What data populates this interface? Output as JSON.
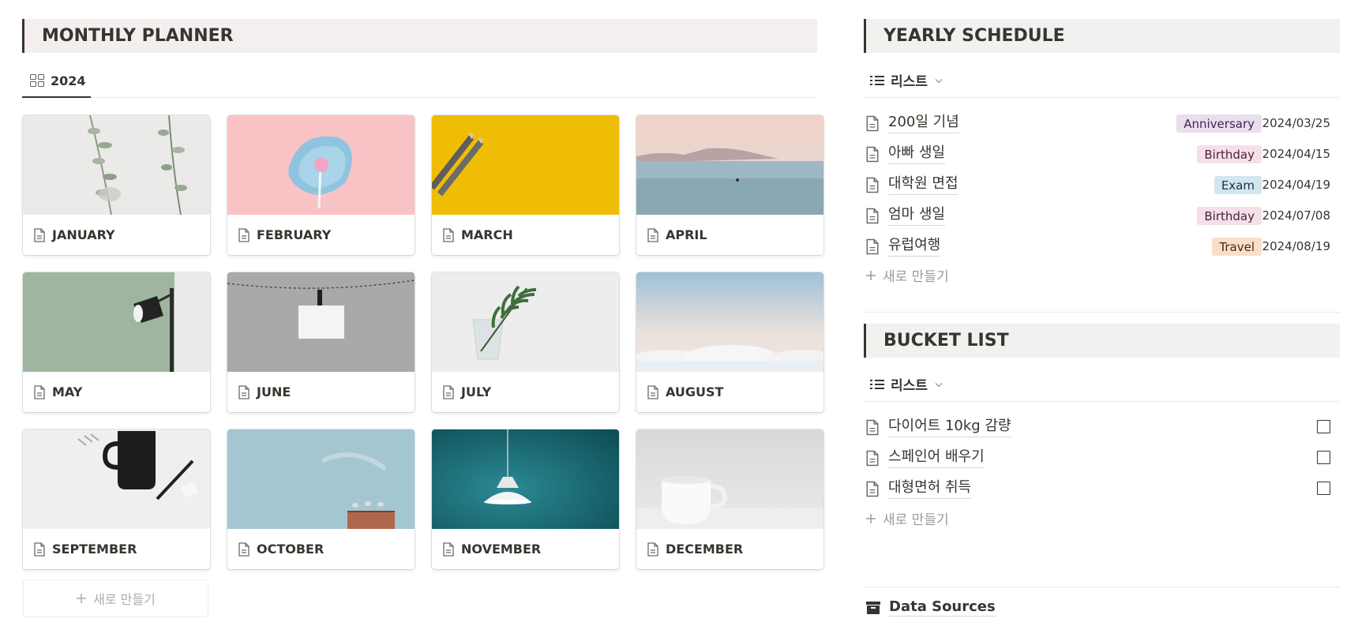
{
  "monthly_planner": {
    "title": "MONTHLY PLANNER",
    "view_tab": "2024",
    "new_label": "새로 만들기",
    "months": [
      {
        "label": "JANUARY",
        "cover": "eucalyptus"
      },
      {
        "label": "FEBRUARY",
        "cover": "pink-lollipop"
      },
      {
        "label": "MARCH",
        "cover": "yellow-pencils"
      },
      {
        "label": "APRIL",
        "cover": "ocean-islands"
      },
      {
        "label": "MAY",
        "cover": "sage-lamp"
      },
      {
        "label": "JUNE",
        "cover": "hanging-card"
      },
      {
        "label": "JULY",
        "cover": "glass-leaf"
      },
      {
        "label": "AUGUST",
        "cover": "clouds-sky"
      },
      {
        "label": "SEPTEMBER",
        "cover": "mug-pen"
      },
      {
        "label": "OCTOBER",
        "cover": "blue-sky-birds"
      },
      {
        "label": "NOVEMBER",
        "cover": "teal-pendant-lamp"
      },
      {
        "label": "DECEMBER",
        "cover": "white-cup"
      }
    ]
  },
  "yearly_schedule": {
    "title": "YEARLY SCHEDULE",
    "view_label": "리스트",
    "new_label": "새로 만들기",
    "items": [
      {
        "name": "200일 기념",
        "tag": "Anniversary",
        "date": "2024/03/25",
        "tag_bg": "#e8deee",
        "tag_fg": "#412454"
      },
      {
        "name": "아빠 생일",
        "tag": "Birthday",
        "date": "2024/04/15",
        "tag_bg": "#f5e0e9",
        "tag_fg": "#4c2337"
      },
      {
        "name": "대학원 면접",
        "tag": "Exam",
        "date": "2024/04/19",
        "tag_bg": "#d3e5ef",
        "tag_fg": "#183347"
      },
      {
        "name": "엄마 생일",
        "tag": "Birthday",
        "date": "2024/07/08",
        "tag_bg": "#f5e0e9",
        "tag_fg": "#4c2337"
      },
      {
        "name": "유럽여행",
        "tag": "Travel",
        "date": "2024/08/19",
        "tag_bg": "#fadec9",
        "tag_fg": "#49290e"
      }
    ]
  },
  "bucket_list": {
    "title": "BUCKET LIST",
    "view_label": "리스트",
    "new_label": "새로 만들기",
    "items": [
      {
        "name": "다이어트 10kg 감량",
        "checked": false
      },
      {
        "name": "스페인어 배우기",
        "checked": false
      },
      {
        "name": "대형면허 취득",
        "checked": false
      }
    ]
  },
  "data_sources": {
    "label": "Data Sources"
  },
  "colors": {
    "text": "#37352f",
    "muted": "#9b9a97",
    "header_bg": "#f1f1ef",
    "monthly_header_bg": "#f4eeee"
  }
}
